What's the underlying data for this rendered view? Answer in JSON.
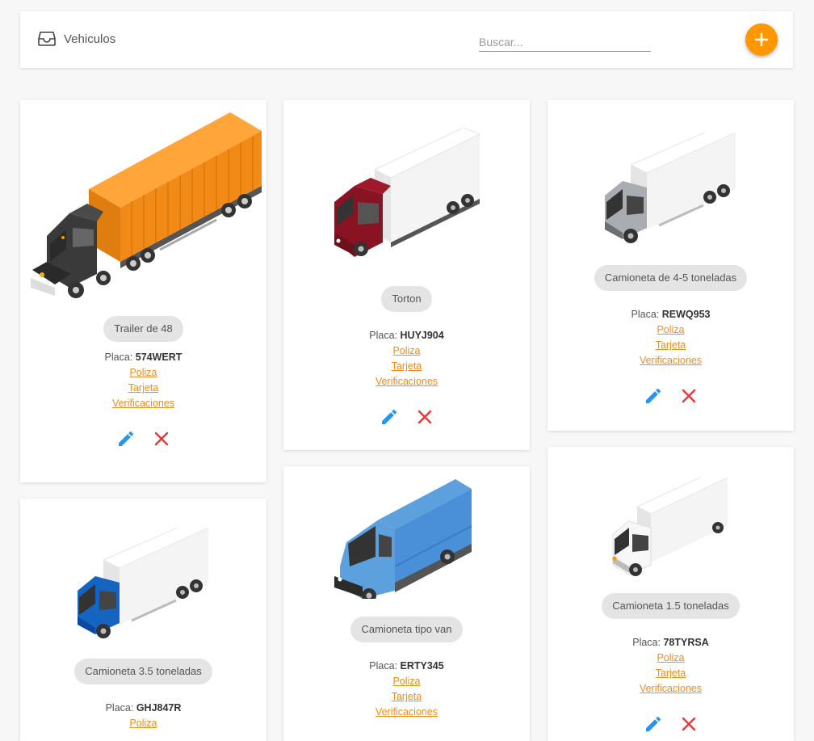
{
  "toolbar": {
    "title": "Vehiculos",
    "icon": "inbox-icon",
    "search_placeholder": "Buscar...",
    "add_button_icon": "plus-icon",
    "accent_color": "#ff9800"
  },
  "link_color": "#f08c1a",
  "edit_color": "#2196f3",
  "delete_color": "#e53935",
  "vehicles": [
    {
      "type": "Trailer de 48",
      "plate_label": "Placa:",
      "plate": "574WERT",
      "links": [
        "Poliza",
        "Tarjeta",
        "Verificaciones"
      ],
      "image": "truck-trailer-orange"
    },
    {
      "type": "Torton",
      "plate_label": "Placa:",
      "plate": "HUYJ904",
      "links": [
        "Poliza",
        "Tarjeta",
        "Verificaciones"
      ],
      "image": "truck-torton-red"
    },
    {
      "type": "Camioneta de 4-5 toneladas",
      "plate_label": "Placa:",
      "plate": "REWQ953",
      "links": [
        "Poliza",
        "Tarjeta",
        "Verificaciones"
      ],
      "image": "truck-box-gray"
    },
    {
      "type": "Camioneta 3.5 toneladas",
      "plate_label": "Placa:",
      "plate": "GHJ847R",
      "links": [
        "Poliza"
      ],
      "image": "truck-box-blue"
    },
    {
      "type": "Camioneta tipo van",
      "plate_label": "Placa:",
      "plate": "ERTY345",
      "links": [
        "Poliza",
        "Tarjeta",
        "Verificaciones"
      ],
      "image": "van-blue"
    },
    {
      "type": "Camioneta 1.5 toneladas",
      "plate_label": "Placa:",
      "plate": "78TYRSA",
      "links": [
        "Poliza",
        "Tarjeta",
        "Verificaciones"
      ],
      "image": "truck-box-white"
    }
  ]
}
